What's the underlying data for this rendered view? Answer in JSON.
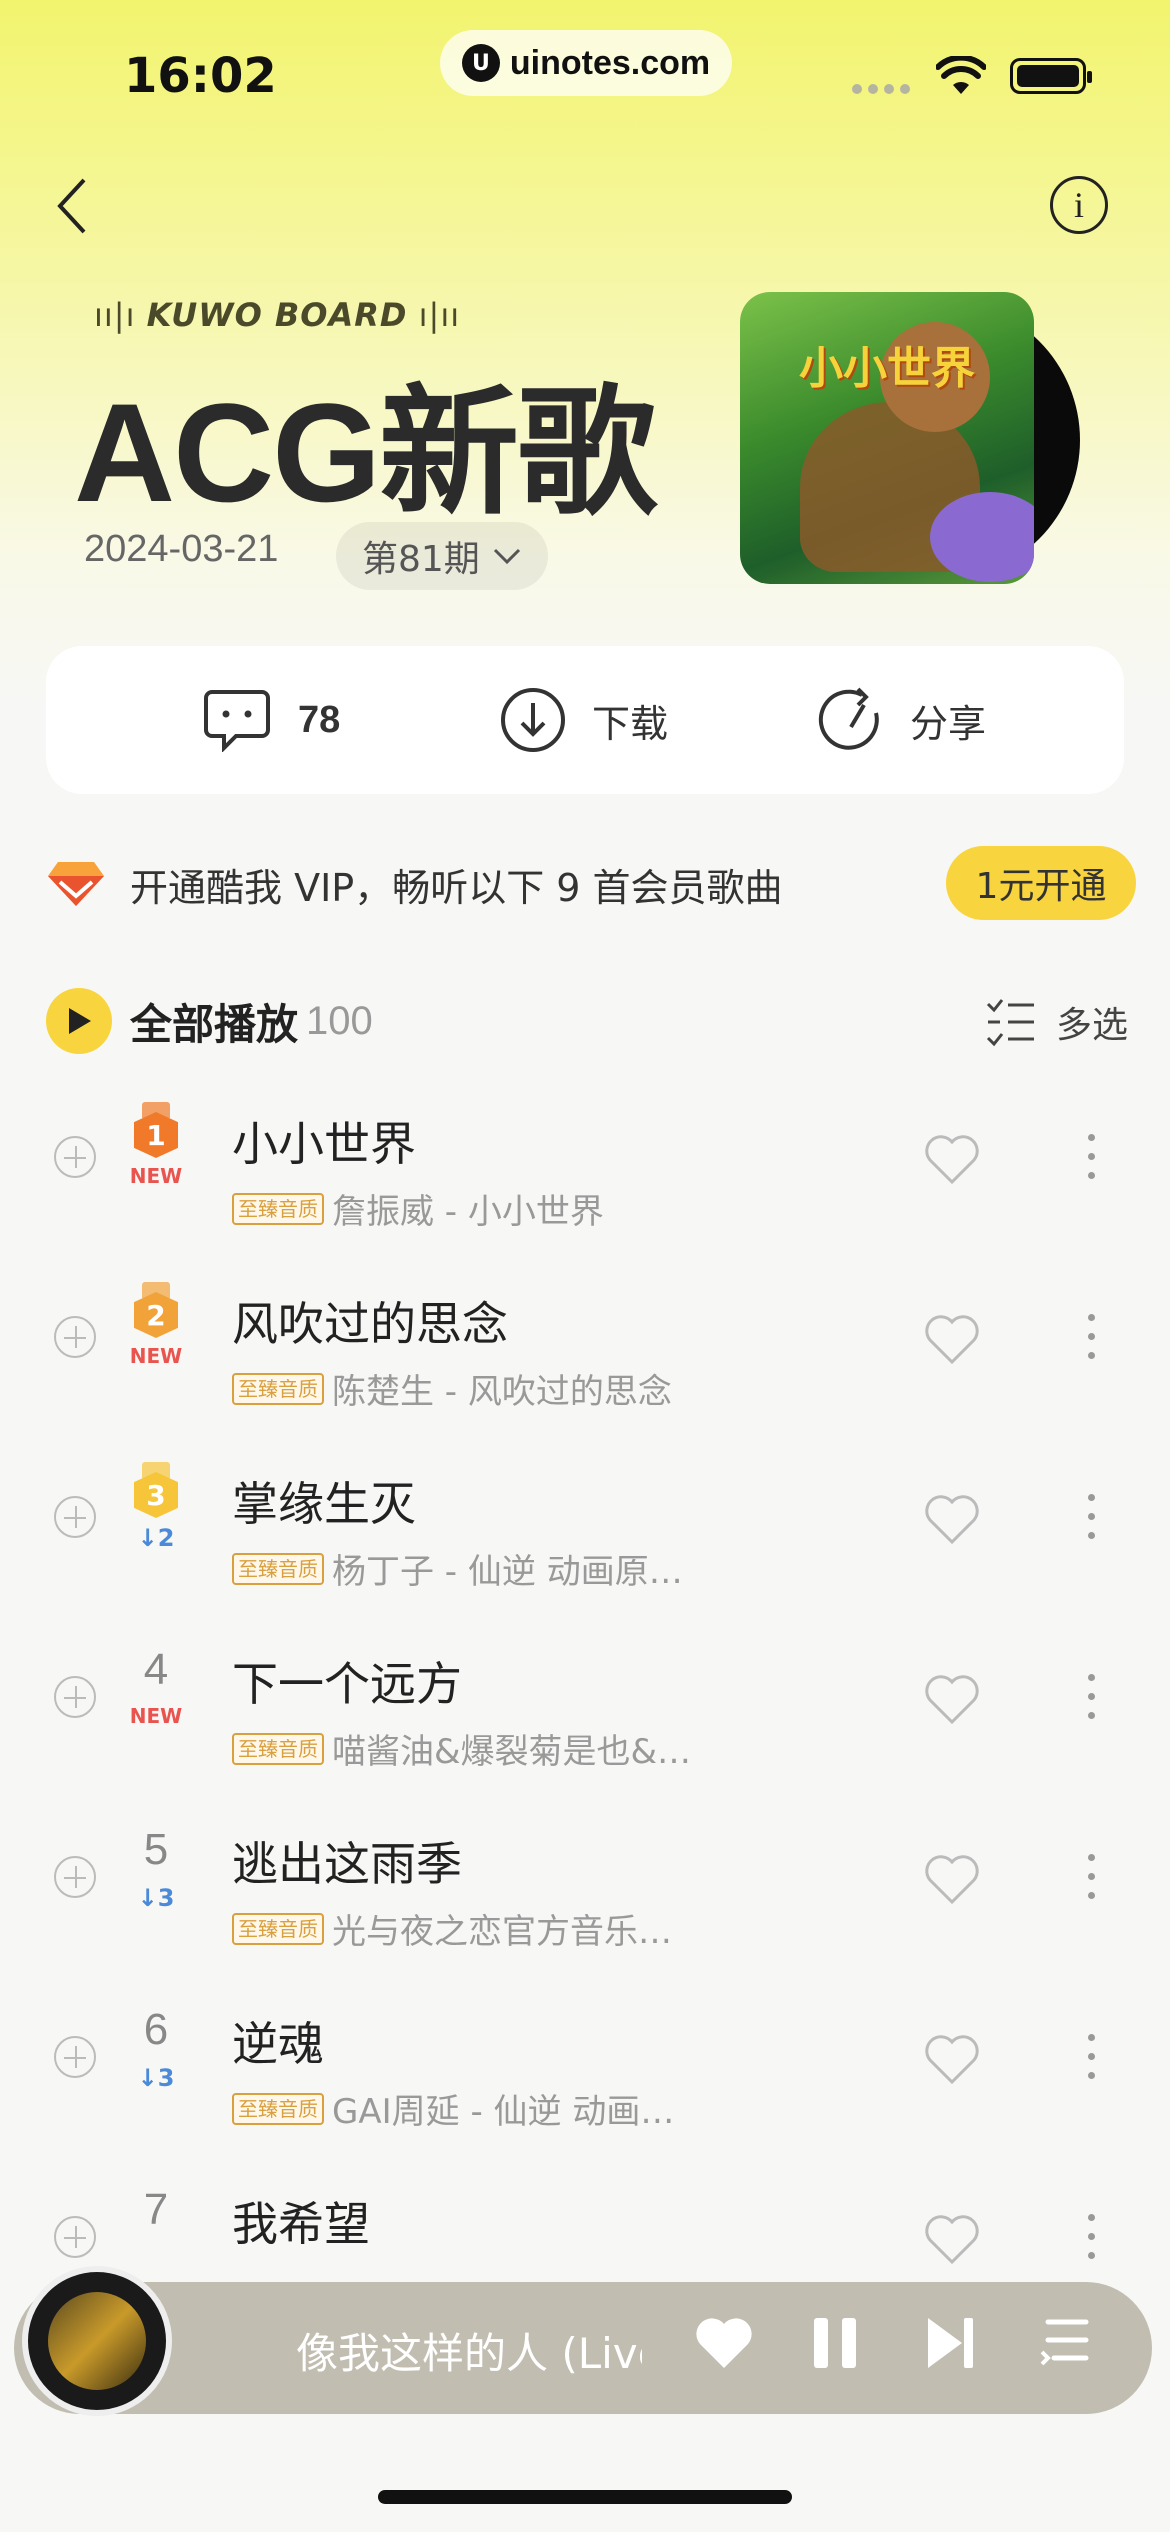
{
  "status": {
    "time": "16:02",
    "url": "uinotes.com"
  },
  "header": {
    "board_label": "KUWO BOARD",
    "title": "ACG新歌",
    "date": "2024-03-21",
    "period": "第81期",
    "cover_title": "小小世界"
  },
  "actions": {
    "comment_count": "78",
    "download": "下载",
    "share": "分享"
  },
  "vip": {
    "text": "开通酷我 VIP，畅听以下 9 首会员歌曲",
    "button": "1元开通"
  },
  "list_header": {
    "play_all": "全部播放",
    "count": "100",
    "multi_select": "多选"
  },
  "quality_badge": "至臻音质",
  "songs": [
    {
      "rank": "1",
      "tag": "NEW",
      "title": "小小世界",
      "sub": "詹振威 - 小小世界",
      "medal": "#f07a2a"
    },
    {
      "rank": "2",
      "tag": "NEW",
      "title": "风吹过的思念",
      "sub": "陈楚生 - 风吹过的思念",
      "medal": "#f1a33a"
    },
    {
      "rank": "3",
      "tag": "↓2",
      "title": "掌缘生灭",
      "sub": "杨丁子 - 仙逆 动画原…",
      "medal": "#f6c53a"
    },
    {
      "rank": "4",
      "tag": "NEW",
      "title": "下一个远方",
      "sub": "喵酱油&爆裂菊是也&…"
    },
    {
      "rank": "5",
      "tag": "↓3",
      "title": "逃出这雨季",
      "sub": "光与夜之恋官方音乐…"
    },
    {
      "rank": "6",
      "tag": "↓3",
      "title": "逆魂",
      "sub": "GAI周延 - 仙逆 动画…"
    },
    {
      "rank": "7",
      "tag": "",
      "title": "我希望",
      "sub": ""
    }
  ],
  "player": {
    "now_playing": "像我这样的人 (Live"
  }
}
